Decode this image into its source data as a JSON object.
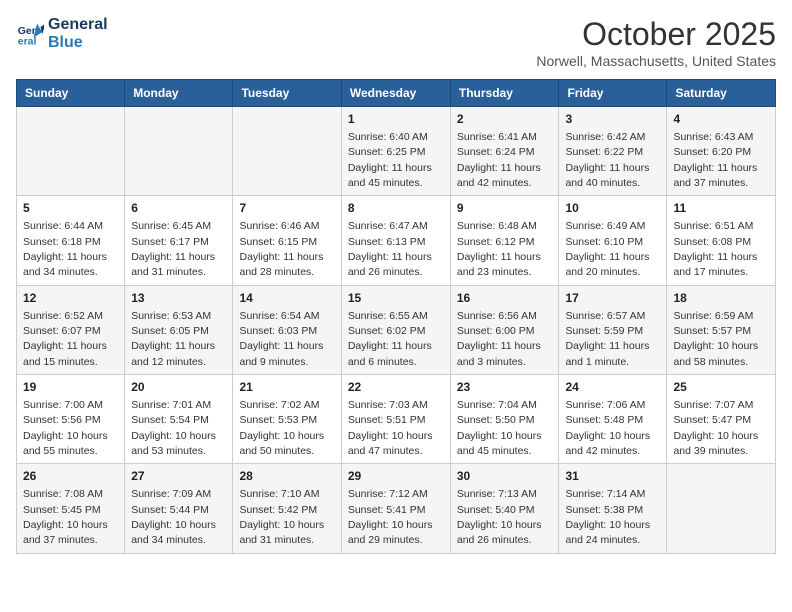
{
  "header": {
    "logo_line1": "General",
    "logo_line2": "Blue",
    "month": "October 2025",
    "location": "Norwell, Massachusetts, United States"
  },
  "weekdays": [
    "Sunday",
    "Monday",
    "Tuesday",
    "Wednesday",
    "Thursday",
    "Friday",
    "Saturday"
  ],
  "weeks": [
    [
      {
        "day": "",
        "info": ""
      },
      {
        "day": "",
        "info": ""
      },
      {
        "day": "",
        "info": ""
      },
      {
        "day": "1",
        "info": "Sunrise: 6:40 AM\nSunset: 6:25 PM\nDaylight: 11 hours\nand 45 minutes."
      },
      {
        "day": "2",
        "info": "Sunrise: 6:41 AM\nSunset: 6:24 PM\nDaylight: 11 hours\nand 42 minutes."
      },
      {
        "day": "3",
        "info": "Sunrise: 6:42 AM\nSunset: 6:22 PM\nDaylight: 11 hours\nand 40 minutes."
      },
      {
        "day": "4",
        "info": "Sunrise: 6:43 AM\nSunset: 6:20 PM\nDaylight: 11 hours\nand 37 minutes."
      }
    ],
    [
      {
        "day": "5",
        "info": "Sunrise: 6:44 AM\nSunset: 6:18 PM\nDaylight: 11 hours\nand 34 minutes."
      },
      {
        "day": "6",
        "info": "Sunrise: 6:45 AM\nSunset: 6:17 PM\nDaylight: 11 hours\nand 31 minutes."
      },
      {
        "day": "7",
        "info": "Sunrise: 6:46 AM\nSunset: 6:15 PM\nDaylight: 11 hours\nand 28 minutes."
      },
      {
        "day": "8",
        "info": "Sunrise: 6:47 AM\nSunset: 6:13 PM\nDaylight: 11 hours\nand 26 minutes."
      },
      {
        "day": "9",
        "info": "Sunrise: 6:48 AM\nSunset: 6:12 PM\nDaylight: 11 hours\nand 23 minutes."
      },
      {
        "day": "10",
        "info": "Sunrise: 6:49 AM\nSunset: 6:10 PM\nDaylight: 11 hours\nand 20 minutes."
      },
      {
        "day": "11",
        "info": "Sunrise: 6:51 AM\nSunset: 6:08 PM\nDaylight: 11 hours\nand 17 minutes."
      }
    ],
    [
      {
        "day": "12",
        "info": "Sunrise: 6:52 AM\nSunset: 6:07 PM\nDaylight: 11 hours\nand 15 minutes."
      },
      {
        "day": "13",
        "info": "Sunrise: 6:53 AM\nSunset: 6:05 PM\nDaylight: 11 hours\nand 12 minutes."
      },
      {
        "day": "14",
        "info": "Sunrise: 6:54 AM\nSunset: 6:03 PM\nDaylight: 11 hours\nand 9 minutes."
      },
      {
        "day": "15",
        "info": "Sunrise: 6:55 AM\nSunset: 6:02 PM\nDaylight: 11 hours\nand 6 minutes."
      },
      {
        "day": "16",
        "info": "Sunrise: 6:56 AM\nSunset: 6:00 PM\nDaylight: 11 hours\nand 3 minutes."
      },
      {
        "day": "17",
        "info": "Sunrise: 6:57 AM\nSunset: 5:59 PM\nDaylight: 11 hours\nand 1 minute."
      },
      {
        "day": "18",
        "info": "Sunrise: 6:59 AM\nSunset: 5:57 PM\nDaylight: 10 hours\nand 58 minutes."
      }
    ],
    [
      {
        "day": "19",
        "info": "Sunrise: 7:00 AM\nSunset: 5:56 PM\nDaylight: 10 hours\nand 55 minutes."
      },
      {
        "day": "20",
        "info": "Sunrise: 7:01 AM\nSunset: 5:54 PM\nDaylight: 10 hours\nand 53 minutes."
      },
      {
        "day": "21",
        "info": "Sunrise: 7:02 AM\nSunset: 5:53 PM\nDaylight: 10 hours\nand 50 minutes."
      },
      {
        "day": "22",
        "info": "Sunrise: 7:03 AM\nSunset: 5:51 PM\nDaylight: 10 hours\nand 47 minutes."
      },
      {
        "day": "23",
        "info": "Sunrise: 7:04 AM\nSunset: 5:50 PM\nDaylight: 10 hours\nand 45 minutes."
      },
      {
        "day": "24",
        "info": "Sunrise: 7:06 AM\nSunset: 5:48 PM\nDaylight: 10 hours\nand 42 minutes."
      },
      {
        "day": "25",
        "info": "Sunrise: 7:07 AM\nSunset: 5:47 PM\nDaylight: 10 hours\nand 39 minutes."
      }
    ],
    [
      {
        "day": "26",
        "info": "Sunrise: 7:08 AM\nSunset: 5:45 PM\nDaylight: 10 hours\nand 37 minutes."
      },
      {
        "day": "27",
        "info": "Sunrise: 7:09 AM\nSunset: 5:44 PM\nDaylight: 10 hours\nand 34 minutes."
      },
      {
        "day": "28",
        "info": "Sunrise: 7:10 AM\nSunset: 5:42 PM\nDaylight: 10 hours\nand 31 minutes."
      },
      {
        "day": "29",
        "info": "Sunrise: 7:12 AM\nSunset: 5:41 PM\nDaylight: 10 hours\nand 29 minutes."
      },
      {
        "day": "30",
        "info": "Sunrise: 7:13 AM\nSunset: 5:40 PM\nDaylight: 10 hours\nand 26 minutes."
      },
      {
        "day": "31",
        "info": "Sunrise: 7:14 AM\nSunset: 5:38 PM\nDaylight: 10 hours\nand 24 minutes."
      },
      {
        "day": "",
        "info": ""
      }
    ]
  ]
}
